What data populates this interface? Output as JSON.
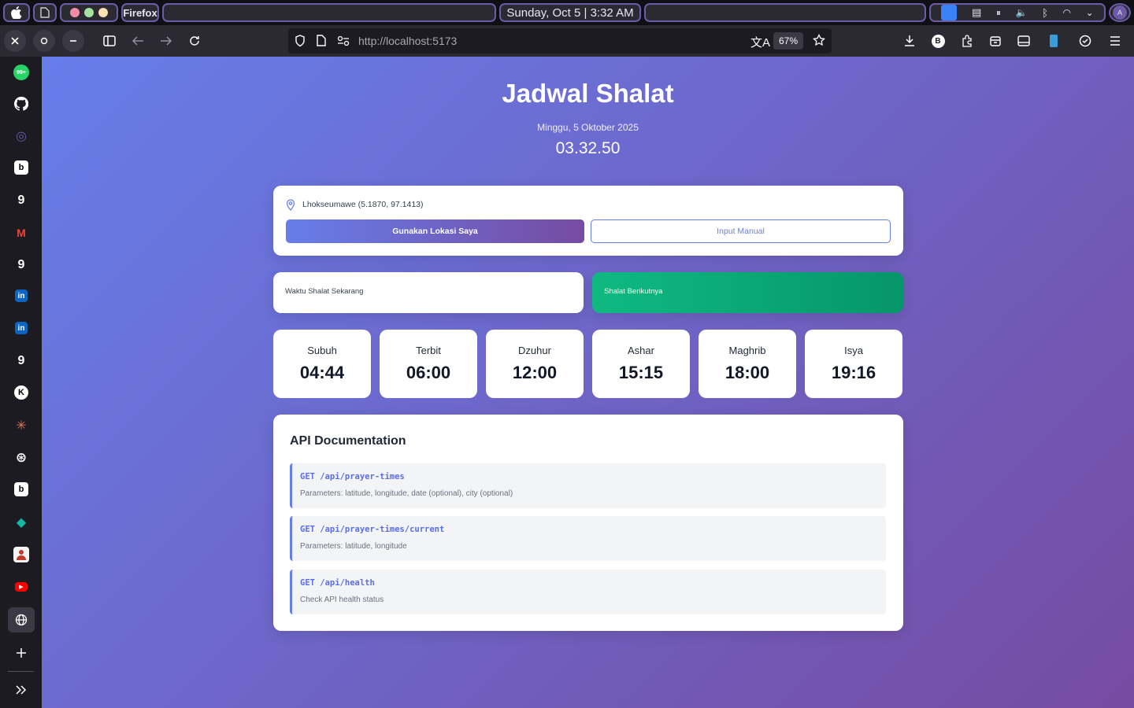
{
  "system": {
    "app_name": "Firefox",
    "datetime": "Sunday, Oct 5 | 3:32 AM",
    "avatar_letter": "A"
  },
  "browser": {
    "url_host": "http://localhost",
    "url_port": ":5173",
    "zoom": "67%",
    "profile_letter": "B"
  },
  "sidebar": {
    "items": [
      {
        "icon": "whatsapp-icon",
        "label": "99+",
        "color": "#25d366"
      },
      {
        "icon": "github-icon",
        "color": "#ffffff"
      },
      {
        "icon": "assistant-icon",
        "color": "#6d5aa8"
      },
      {
        "icon": "b-app-icon",
        "label": "b",
        "color": "#000000"
      },
      {
        "icon": "g-app-icon",
        "label": "9",
        "color": "#1c1b22"
      },
      {
        "icon": "gmail-icon",
        "label": "M",
        "color": "#ea4335"
      },
      {
        "icon": "g-app-icon",
        "label": "9",
        "color": "#1c1b22"
      },
      {
        "icon": "linkedin-icon",
        "label": "in",
        "color": "#0a66c2"
      },
      {
        "icon": "linkedin-icon",
        "label": "in",
        "color": "#0a66c2"
      },
      {
        "icon": "g-app-icon",
        "label": "9",
        "color": "#1c1b22"
      },
      {
        "icon": "k-app-icon",
        "label": "K",
        "color": "#000000"
      },
      {
        "icon": "claude-icon",
        "label": "✳",
        "color": "#d97757"
      },
      {
        "icon": "openai-icon",
        "label": "⊛",
        "color": "#1c1b22"
      },
      {
        "icon": "b-app-icon",
        "label": "b",
        "color": "#000000"
      },
      {
        "icon": "diamond-app-icon",
        "label": "◆",
        "color": "#1c1b22"
      },
      {
        "icon": "profile-app-icon",
        "color": "#ffffff"
      },
      {
        "icon": "youtube-icon",
        "label": "▶",
        "color": "#ff0000"
      }
    ]
  },
  "page": {
    "title": "Jadwal Shalat",
    "date": "Minggu, 5 Oktober 2025",
    "clock": "03.32.50",
    "location": "Lhokseumawe (5.1870, 97.1413)",
    "use_location_button": "Gunakan Lokasi Saya",
    "manual_button": "Input Manual",
    "current_label": "Waktu Shalat Sekarang",
    "next_label": "Shalat Berikutnya",
    "prayers": [
      {
        "name": "Subuh",
        "time": "04:44"
      },
      {
        "name": "Terbit",
        "time": "06:00"
      },
      {
        "name": "Dzuhur",
        "time": "12:00"
      },
      {
        "name": "Ashar",
        "time": "15:15"
      },
      {
        "name": "Maghrib",
        "time": "18:00"
      },
      {
        "name": "Isya",
        "time": "19:16"
      }
    ],
    "api": {
      "title": "API Documentation",
      "endpoints": [
        {
          "method": "GET /api/prayer-times",
          "desc": "Parameters: latitude, longitude, date (optional), city (optional)"
        },
        {
          "method": "GET /api/prayer-times/current",
          "desc": "Parameters: latitude, longitude"
        },
        {
          "method": "GET /api/health",
          "desc": "Check API health status"
        }
      ]
    }
  },
  "colors": {
    "gradient_start": "#667eea",
    "gradient_end": "#764ba2",
    "next_prayer": "#10b981"
  }
}
